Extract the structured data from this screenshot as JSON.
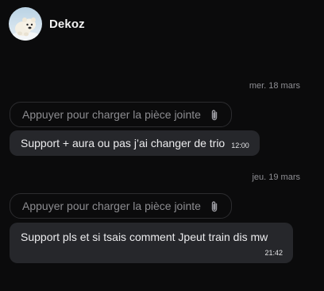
{
  "header": {
    "contact_name": "Dekoz",
    "avatar_icon": "polar-bear-avatar"
  },
  "messages": [
    {
      "date": "mer. 18 mars",
      "attachment_label": "Appuyer pour charger la pièce jointe",
      "attachment_icon": "paperclip-icon",
      "text": "Support + aura ou pas j’ai changer de trio",
      "time": "12:00"
    },
    {
      "date": "jeu. 19 mars",
      "attachment_label": "Appuyer pour charger la pièce jointe",
      "attachment_icon": "paperclip-icon",
      "text": "Support pls et si tsais comment Jpeut train dis mw",
      "time": "21:42"
    }
  ],
  "colors": {
    "background": "#0b0b0c",
    "bubble": "#26272b",
    "pill_border": "#2c2c2f",
    "muted_text": "#8e8e93"
  }
}
